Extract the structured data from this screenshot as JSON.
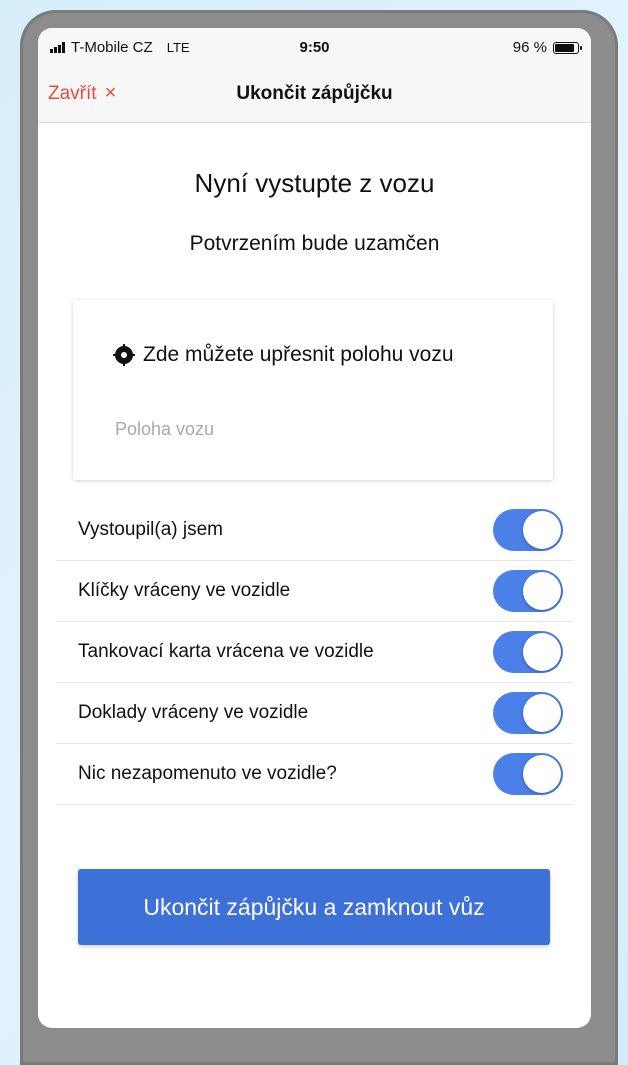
{
  "status_bar": {
    "carrier": "T-Mobile CZ",
    "network": "LTE",
    "time": "9:50",
    "battery_text": "96 %",
    "battery_level": 0.96
  },
  "nav": {
    "close_label": "Zavřít",
    "close_glyph": "×",
    "title": "Ukončit zápůjčku"
  },
  "content": {
    "heading": "Nyní vystupte z vozu",
    "subheading": "Potvrzením bude uzamčen"
  },
  "location_card": {
    "icon": "location-target-icon",
    "title": "Zde můžete upřesnit polohu vozu",
    "input_value": "",
    "input_placeholder": "Poloha vozu"
  },
  "checklist": [
    {
      "label": "Vystoupil(a) jsem",
      "on": true
    },
    {
      "label": "Klíčky vráceny ve vozidle",
      "on": true
    },
    {
      "label": "Tankovací karta vrácena ve vozidle",
      "on": true
    },
    {
      "label": "Doklady vráceny ve vozidle",
      "on": true
    },
    {
      "label": "Nic nezapomenuto ve vozidle?",
      "on": true
    }
  ],
  "primary_action": {
    "label": "Ukončit zápůjčku a zamknout vůz"
  },
  "colors": {
    "accent": "#3e71d7",
    "switch_on": "#4a80e8",
    "close_red": "#e8493f"
  }
}
